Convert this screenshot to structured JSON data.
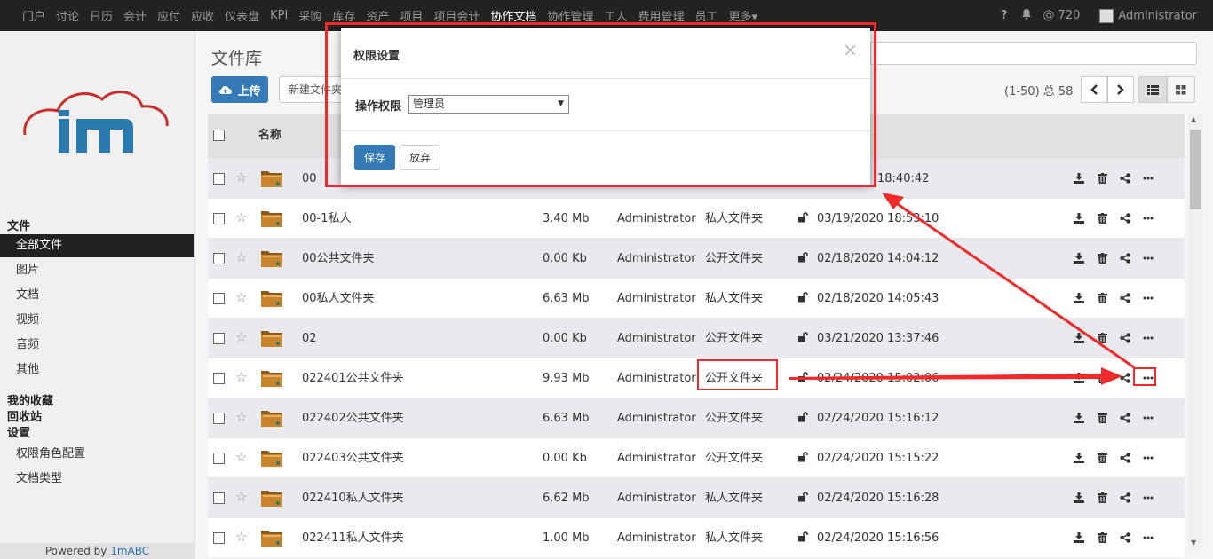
{
  "nav": {
    "items": [
      "门户",
      "讨论",
      "日历",
      "会计",
      "应付",
      "应收",
      "仪表盘",
      "KPI",
      "采购",
      "库存",
      "资产",
      "项目",
      "项目会计",
      "协作文档",
      "协作管理",
      "工人",
      "费用管理",
      "员工",
      "更多▾"
    ],
    "active_index": 13,
    "help": "?",
    "mentions": "@ 720",
    "user": "Administrator"
  },
  "sidebar": {
    "section_files": "文件",
    "file_items": [
      "全部文件",
      "图片",
      "文档",
      "视频",
      "音频",
      "其他"
    ],
    "active_index": 0,
    "favorites": "我的收藏",
    "recycle": "回收站",
    "settings": "设置",
    "settings_items": [
      "权限角色配置",
      "文档类型"
    ],
    "powered_prefix": "Powered by ",
    "powered_brand": "1mABC"
  },
  "main": {
    "title": "文件库",
    "upload": "上传",
    "new_folder": "新建文件夹",
    "pager": "(1-50) 总 58",
    "header_name": "名称"
  },
  "rows": [
    {
      "name": "00",
      "size": "",
      "owner": "",
      "type": "",
      "date": "18:40:42"
    },
    {
      "name": "00-1私人",
      "size": "3.40 Mb",
      "owner": "Administrator",
      "type": "私人文件夹",
      "date": "03/19/2020 18:53:10"
    },
    {
      "name": "00公共文件夹",
      "size": "0.00 Kb",
      "owner": "Administrator",
      "type": "公开文件夹",
      "date": "02/18/2020 14:04:12"
    },
    {
      "name": "00私人文件夹",
      "size": "6.63 Mb",
      "owner": "Administrator",
      "type": "私人文件夹",
      "date": "02/18/2020 14:05:43"
    },
    {
      "name": "02",
      "size": "0.00 Kb",
      "owner": "Administrator",
      "type": "公开文件夹",
      "date": "03/21/2020 13:37:46"
    },
    {
      "name": "022401公共文件夹",
      "size": "9.93 Mb",
      "owner": "Administrator",
      "type": "公开文件夹",
      "date": "02/24/2020 15:02:06"
    },
    {
      "name": "022402公共文件夹",
      "size": "6.63 Mb",
      "owner": "Administrator",
      "type": "公开文件夹",
      "date": "02/24/2020 15:16:12"
    },
    {
      "name": "022403公共文件夹",
      "size": "0.00 Kb",
      "owner": "Administrator",
      "type": "公开文件夹",
      "date": "02/24/2020 15:15:22"
    },
    {
      "name": "022410私人文件夹",
      "size": "6.62 Mb",
      "owner": "Administrator",
      "type": "私人文件夹",
      "date": "02/24/2020 15:16:28"
    },
    {
      "name": "022411私人文件夹",
      "size": "1.00 Mb",
      "owner": "Administrator",
      "type": "私人文件夹",
      "date": "02/24/2020 15:16:56"
    }
  ],
  "modal": {
    "title": "权限设置",
    "close": "×",
    "label": "操作权限",
    "selected": "管理员",
    "save": "保存",
    "cancel": "放弃"
  },
  "colors": {
    "primary": "#337ab7",
    "annotation": "#f02a2a",
    "folder": "#c9852e",
    "nav_bg": "#222222"
  }
}
